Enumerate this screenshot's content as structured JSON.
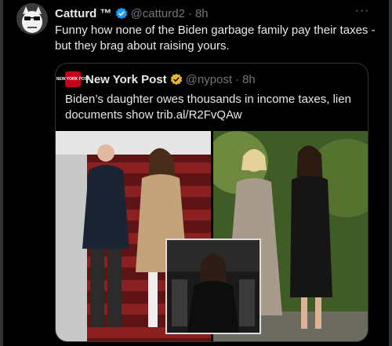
{
  "tweet": {
    "author_name": "Catturd ™",
    "handle": "@catturd2",
    "separator": "·",
    "time": "8h",
    "text": "Funny how none of the Biden garbage family pay their taxes - but they brag about raising yours.",
    "more_icon": "more-icon"
  },
  "quote": {
    "author_name": "New York Post",
    "handle": "@nypost",
    "separator": "·",
    "time": "8h",
    "text": "Biden’s daughter owes thousands in income taxes, lien documents show trib.al/R2FvQAw",
    "logo_text": "NEW YORK POST"
  },
  "colors": {
    "background": "#000000",
    "text": "#e7e9ea",
    "muted": "#71767b",
    "verified_blue": "#1d9bf0",
    "verified_gold": "#e8b829",
    "border": "#2f3336"
  }
}
